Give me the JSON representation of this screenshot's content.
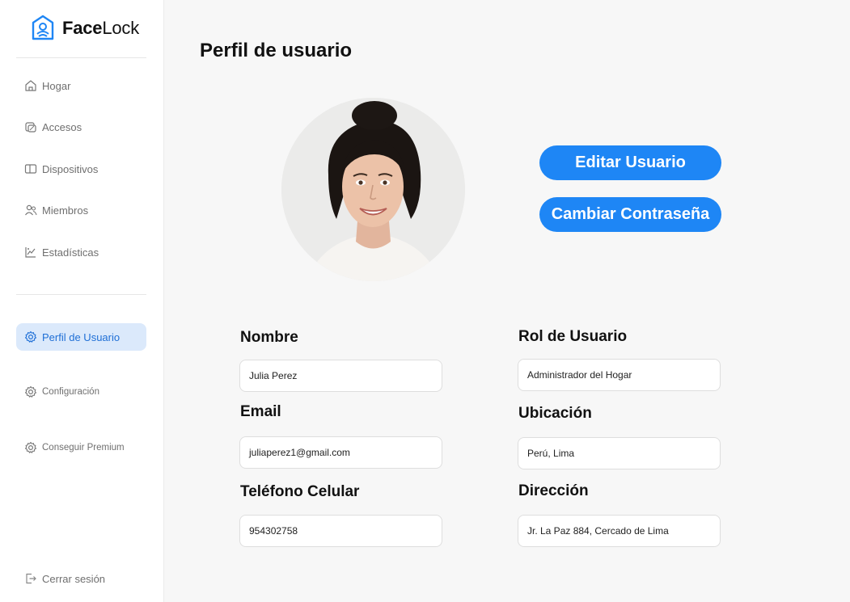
{
  "brand": {
    "bold": "Face",
    "regular": "Lock"
  },
  "sidebar": {
    "items": [
      {
        "label": "Hogar",
        "icon": "home-icon"
      },
      {
        "label": "Accesos",
        "icon": "access-icon"
      },
      {
        "label": "Dispositivos",
        "icon": "devices-icon"
      },
      {
        "label": "Miembros",
        "icon": "members-icon"
      },
      {
        "label": "Estadísticas",
        "icon": "stats-icon"
      }
    ],
    "secondary": [
      {
        "label": "Perfil de Usuario",
        "icon": "gear-icon",
        "active": true
      },
      {
        "label": "Configuración",
        "icon": "gear-icon"
      },
      {
        "label": "Conseguir Premium",
        "icon": "gear-icon"
      }
    ],
    "logout": {
      "label": "Cerrar sesión",
      "icon": "logout-icon"
    }
  },
  "page": {
    "title": "Perfil de usuario",
    "edit_button": "Editar Usuario",
    "password_button": "Cambiar Contraseña"
  },
  "fields": {
    "nombre": {
      "label": "Nombre",
      "value": "Julia Perez"
    },
    "email": {
      "label": "Email",
      "value": "juliaperez1@gmail.com"
    },
    "telefono": {
      "label": "Teléfono Celular",
      "value": "954302758"
    },
    "rol": {
      "label": "Rol de Usuario",
      "value": "Administrador del Hogar"
    },
    "ubicacion": {
      "label": "Ubicación",
      "value": "Perú, Lima"
    },
    "direccion": {
      "label": "Dirección",
      "value": "Jr. La Paz 884, Cercado de Lima"
    }
  },
  "colors": {
    "accent": "#1e86f5",
    "active_bg": "#dbe9fb",
    "active_text": "#1f6fd6"
  }
}
